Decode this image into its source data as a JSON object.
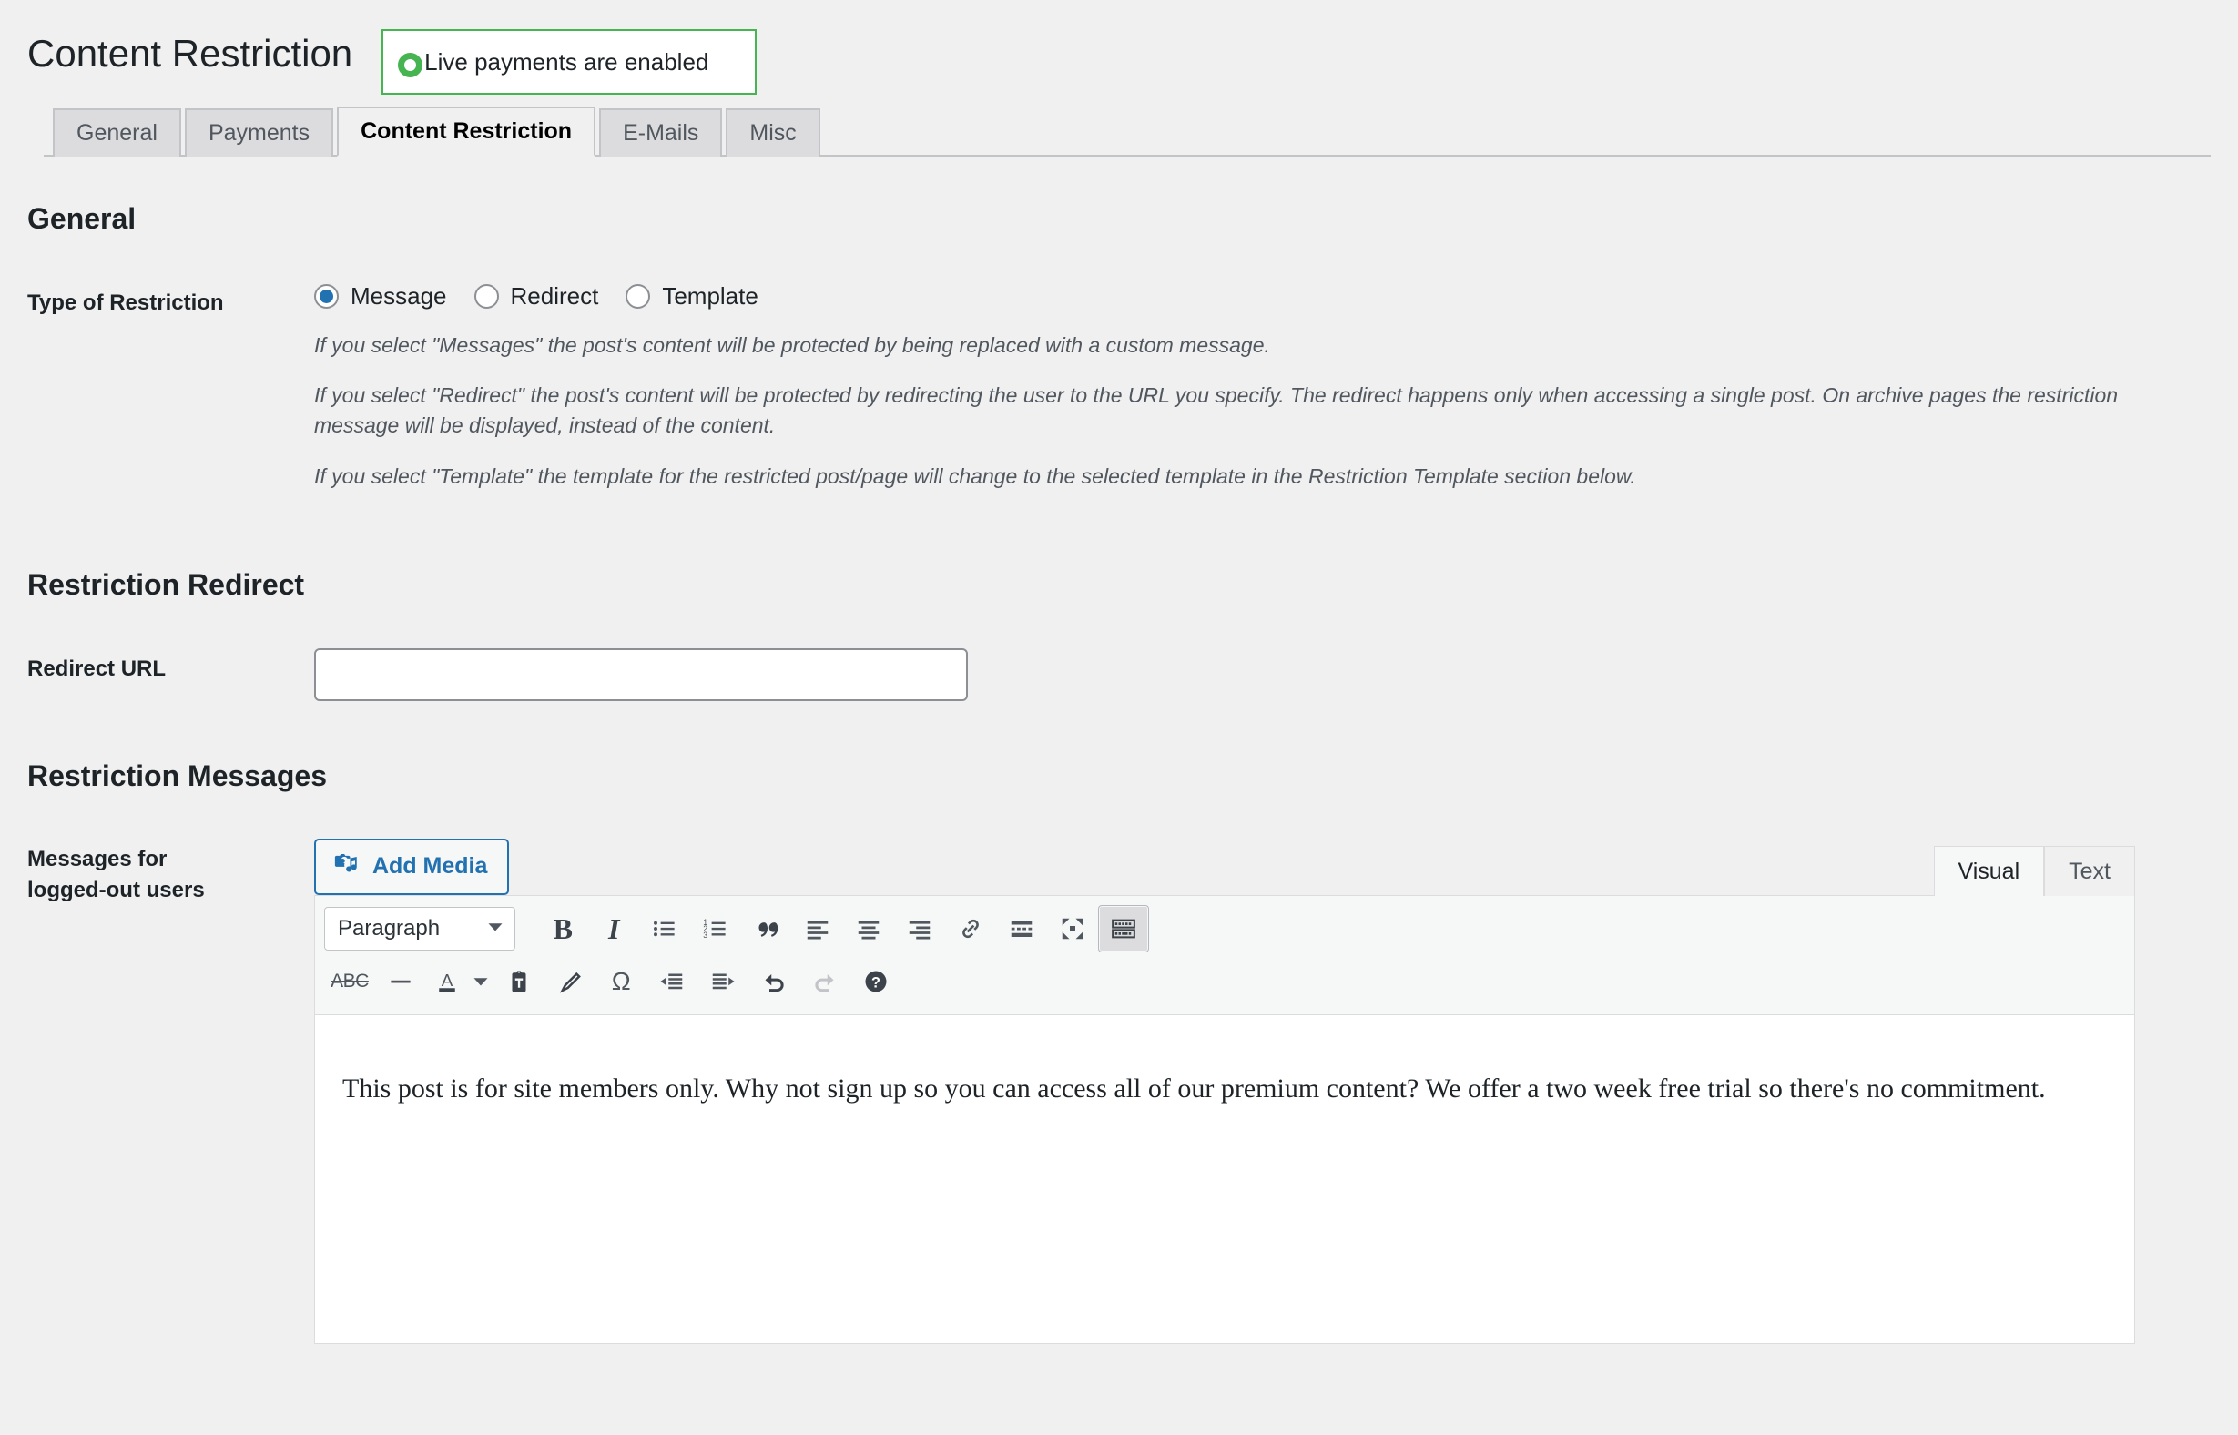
{
  "header": {
    "title": "Content Restriction",
    "notice": {
      "icon": "circle-ring-icon",
      "text": "Live payments are enabled",
      "border_color": "#46b450",
      "icon_color": "#46b450"
    }
  },
  "tabs": [
    {
      "label": "General",
      "active": false
    },
    {
      "label": "Payments",
      "active": false
    },
    {
      "label": "Content Restriction",
      "active": true
    },
    {
      "label": "E-Mails",
      "active": false
    },
    {
      "label": "Misc",
      "active": false
    }
  ],
  "sections": {
    "general": {
      "title": "General",
      "restriction_type": {
        "label": "Type of Restriction",
        "options": [
          {
            "label": "Message",
            "checked": true
          },
          {
            "label": "Redirect",
            "checked": false
          },
          {
            "label": "Template",
            "checked": false
          }
        ],
        "descriptions": [
          "If you select \"Messages\" the post's content will be protected by being replaced with a custom message.",
          "If you select \"Redirect\" the post's content will be protected by redirecting the user to the URL you specify. The redirect happens only when accessing a single post. On archive pages the restriction message will be displayed, instead of the content.",
          "If you select \"Template\" the template for the restricted post/page will change to the selected template in the Restriction Template section below."
        ]
      }
    },
    "restriction_redirect": {
      "title": "Restriction Redirect",
      "redirect_url": {
        "label": "Redirect URL",
        "value": "",
        "placeholder": ""
      }
    },
    "restriction_messages": {
      "title": "Restriction Messages",
      "logged_out": {
        "label": "Messages for logged-out users",
        "add_media_label": "Add Media",
        "add_media_icon": "camera-music-icon",
        "editor_tabs": [
          {
            "label": "Visual",
            "active": true
          },
          {
            "label": "Text",
            "active": false
          }
        ],
        "toolbar_row1": [
          {
            "name": "paragraph-format-select",
            "label": "Paragraph",
            "type": "select"
          },
          {
            "name": "bold-icon",
            "label": "B",
            "type": "icon"
          },
          {
            "name": "italic-icon",
            "label": "I",
            "type": "icon"
          },
          {
            "name": "bulleted-list-icon",
            "label": "",
            "type": "icon"
          },
          {
            "name": "numbered-list-icon",
            "label": "",
            "type": "icon"
          },
          {
            "name": "blockquote-icon",
            "label": "",
            "type": "icon"
          },
          {
            "name": "align-left-icon",
            "label": "",
            "type": "icon"
          },
          {
            "name": "align-center-icon",
            "label": "",
            "type": "icon"
          },
          {
            "name": "align-right-icon",
            "label": "",
            "type": "icon"
          },
          {
            "name": "link-icon",
            "label": "",
            "type": "icon"
          },
          {
            "name": "read-more-icon",
            "label": "",
            "type": "icon"
          },
          {
            "name": "fullscreen-icon",
            "label": "",
            "type": "icon"
          },
          {
            "name": "toolbar-toggle-icon",
            "label": "",
            "type": "icon",
            "active": true
          }
        ],
        "toolbar_row2": [
          {
            "name": "strikethrough-icon",
            "label": "ABC",
            "type": "icon"
          },
          {
            "name": "horizontal-rule-icon",
            "label": "",
            "type": "icon"
          },
          {
            "name": "text-color-icon",
            "label": "A",
            "type": "icon"
          },
          {
            "name": "text-color-dropdown-icon",
            "label": "",
            "type": "caret"
          },
          {
            "name": "paste-as-text-icon",
            "label": "",
            "type": "icon"
          },
          {
            "name": "clear-formatting-icon",
            "label": "",
            "type": "icon"
          },
          {
            "name": "special-character-icon",
            "label": "Ω",
            "type": "icon"
          },
          {
            "name": "outdent-icon",
            "label": "",
            "type": "icon"
          },
          {
            "name": "indent-icon",
            "label": "",
            "type": "icon"
          },
          {
            "name": "undo-icon",
            "label": "",
            "type": "icon"
          },
          {
            "name": "redo-icon",
            "label": "",
            "type": "icon",
            "disabled": true
          },
          {
            "name": "keyboard-shortcuts-help-icon",
            "label": "?",
            "type": "icon"
          }
        ],
        "content": "This post is for site members only. Why not sign up so you can access all of our premium content? We offer a two week free trial so there's no commitment."
      }
    }
  },
  "colors": {
    "accent_blue": "#2271b1",
    "success_green": "#46b450",
    "page_bg": "#f0f0f1",
    "text": "#1d2327",
    "muted_text": "#50575e"
  }
}
